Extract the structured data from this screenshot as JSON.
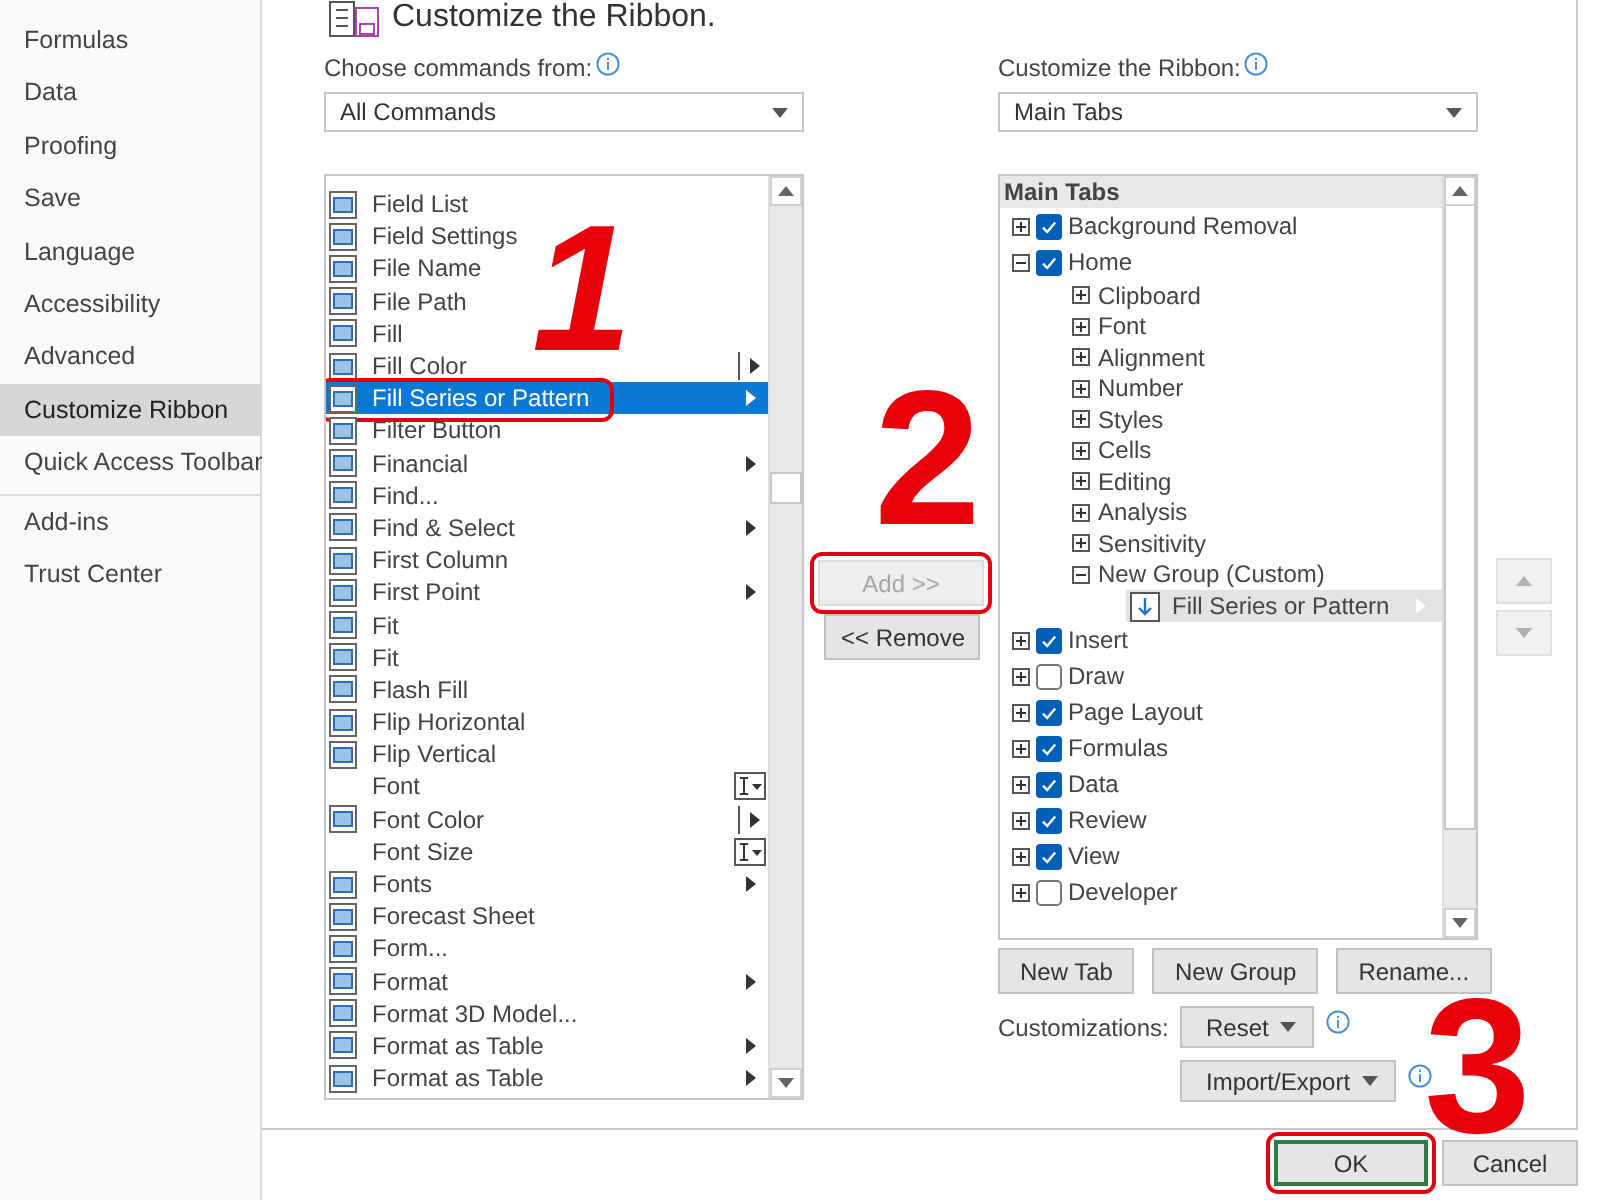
{
  "sidebar": {
    "sections": [
      {
        "items": [
          {
            "label": "Formulas",
            "selected": false
          },
          {
            "label": "Data",
            "selected": false
          },
          {
            "label": "Proofing",
            "selected": false
          },
          {
            "label": "Save",
            "selected": false
          },
          {
            "label": "Language",
            "selected": false
          },
          {
            "label": "Accessibility",
            "selected": false
          },
          {
            "label": "Advanced",
            "selected": false
          },
          {
            "label": "Customize Ribbon",
            "selected": true
          },
          {
            "label": "Quick Access Toolbar",
            "selected": false
          }
        ]
      },
      {
        "items": [
          {
            "label": "Add-ins",
            "selected": false
          },
          {
            "label": "Trust Center",
            "selected": false
          }
        ]
      }
    ]
  },
  "title": "Customize the Ribbon.",
  "commands_panel": {
    "label": "Choose commands from:",
    "dropdown": "All Commands",
    "items": [
      {
        "label": "Field List",
        "kind": "plain",
        "icon": true,
        "selected": false,
        "highlighted": false
      },
      {
        "label": "Field Settings",
        "kind": "plain",
        "icon": true,
        "selected": false,
        "highlighted": false
      },
      {
        "label": "File Name",
        "kind": "plain",
        "icon": true,
        "selected": false,
        "highlighted": false
      },
      {
        "label": "File Path",
        "kind": "plain",
        "icon": true,
        "selected": false,
        "highlighted": false
      },
      {
        "label": "Fill",
        "kind": "plain",
        "icon": true,
        "selected": false,
        "highlighted": false
      },
      {
        "label": "Fill Color",
        "kind": "split",
        "icon": true,
        "selected": false,
        "highlighted": false
      },
      {
        "label": "Fill Series or Pattern",
        "kind": "submenu",
        "icon": true,
        "selected": true,
        "highlighted": true
      },
      {
        "label": "Filter Button",
        "kind": "plain",
        "icon": true,
        "selected": false,
        "highlighted": false
      },
      {
        "label": "Financial",
        "kind": "submenu",
        "icon": true,
        "selected": false,
        "highlighted": false
      },
      {
        "label": "Find...",
        "kind": "plain",
        "icon": true,
        "selected": false,
        "highlighted": false
      },
      {
        "label": "Find & Select",
        "kind": "submenu",
        "icon": true,
        "selected": false,
        "highlighted": false
      },
      {
        "label": "First Column",
        "kind": "plain",
        "icon": true,
        "selected": false,
        "highlighted": false
      },
      {
        "label": "First Point",
        "kind": "submenu",
        "icon": true,
        "selected": false,
        "highlighted": false
      },
      {
        "label": "Fit",
        "kind": "plain",
        "icon": true,
        "selected": false,
        "highlighted": false
      },
      {
        "label": "Fit",
        "kind": "plain",
        "icon": true,
        "selected": false,
        "highlighted": false
      },
      {
        "label": "Flash Fill",
        "kind": "plain",
        "icon": true,
        "selected": false,
        "highlighted": false
      },
      {
        "label": "Flip Horizontal",
        "kind": "plain",
        "icon": true,
        "selected": false,
        "highlighted": false
      },
      {
        "label": "Flip Vertical",
        "kind": "plain",
        "icon": true,
        "selected": false,
        "highlighted": false
      },
      {
        "label": "Font",
        "kind": "textbox",
        "icon": false,
        "selected": false,
        "highlighted": false
      },
      {
        "label": "Font Color",
        "kind": "split",
        "icon": true,
        "selected": false,
        "highlighted": false
      },
      {
        "label": "Font Size",
        "kind": "textbox",
        "icon": false,
        "selected": false,
        "highlighted": false
      },
      {
        "label": "Fonts",
        "kind": "submenu",
        "icon": true,
        "selected": false,
        "highlighted": false
      },
      {
        "label": "Forecast Sheet",
        "kind": "plain",
        "icon": true,
        "selected": false,
        "highlighted": false
      },
      {
        "label": "Form...",
        "kind": "plain",
        "icon": true,
        "selected": false,
        "highlighted": false
      },
      {
        "label": "Format",
        "kind": "submenu",
        "icon": true,
        "selected": false,
        "highlighted": false
      },
      {
        "label": "Format 3D Model...",
        "kind": "plain",
        "icon": true,
        "selected": false,
        "highlighted": false
      },
      {
        "label": "Format as Table",
        "kind": "submenu",
        "icon": true,
        "selected": false,
        "highlighted": false
      },
      {
        "label": "Format as Table",
        "kind": "submenu",
        "icon": true,
        "selected": false,
        "highlighted": false
      }
    ]
  },
  "transfer_buttons": [
    {
      "label": "Add >>",
      "disabled": true,
      "highlighted": true
    },
    {
      "label": "<< Remove",
      "disabled": false,
      "highlighted": false
    }
  ],
  "ribbon_panel": {
    "label": "Customize the Ribbon:",
    "dropdown": "Main Tabs",
    "tree_header": "Main Tabs",
    "tree": [
      {
        "label": "Background Removal",
        "kind": "tab",
        "checked": true,
        "expanded": false,
        "selected": false
      },
      {
        "label": "Home",
        "kind": "tab",
        "checked": true,
        "expanded": true,
        "selected": false,
        "children": [
          {
            "label": "Clipboard",
            "kind": "group",
            "expanded": false,
            "selected": false
          },
          {
            "label": "Font",
            "kind": "group",
            "expanded": false,
            "selected": false
          },
          {
            "label": "Alignment",
            "kind": "group",
            "expanded": false,
            "selected": false
          },
          {
            "label": "Number",
            "kind": "group",
            "expanded": false,
            "selected": false
          },
          {
            "label": "Styles",
            "kind": "group",
            "expanded": false,
            "selected": false
          },
          {
            "label": "Cells",
            "kind": "group",
            "expanded": false,
            "selected": false
          },
          {
            "label": "Editing",
            "kind": "group",
            "expanded": false,
            "selected": false
          },
          {
            "label": "Analysis",
            "kind": "group",
            "expanded": false,
            "selected": false
          },
          {
            "label": "Sensitivity",
            "kind": "group",
            "expanded": false,
            "selected": false
          },
          {
            "label": "New Group (Custom)",
            "kind": "group",
            "expanded": true,
            "selected": false,
            "children": [
              {
                "label": "Fill Series or Pattern",
                "kind": "command",
                "selected": true
              }
            ]
          }
        ]
      },
      {
        "label": "Insert",
        "kind": "tab",
        "checked": true,
        "expanded": false,
        "selected": false
      },
      {
        "label": "Draw",
        "kind": "tab",
        "checked": false,
        "expanded": false,
        "selected": false
      },
      {
        "label": "Page Layout",
        "kind": "tab",
        "checked": true,
        "expanded": false,
        "selected": false
      },
      {
        "label": "Formulas",
        "kind": "tab",
        "checked": true,
        "expanded": false,
        "selected": false
      },
      {
        "label": "Data",
        "kind": "tab",
        "checked": true,
        "expanded": false,
        "selected": false
      },
      {
        "label": "Review",
        "kind": "tab",
        "checked": true,
        "expanded": false,
        "selected": false
      },
      {
        "label": "View",
        "kind": "tab",
        "checked": true,
        "expanded": false,
        "selected": false
      },
      {
        "label": "Developer",
        "kind": "tab",
        "checked": false,
        "expanded": false,
        "selected": false
      }
    ]
  },
  "move_buttons": [
    {
      "kind": "up",
      "disabled": true
    },
    {
      "kind": "down",
      "disabled": true
    }
  ],
  "tree_buttons": [
    {
      "label": "New Tab"
    },
    {
      "label": "New Group"
    },
    {
      "label": "Rename..."
    }
  ],
  "customizations": {
    "label": "Customizations:",
    "buttons": [
      {
        "label": "Reset"
      },
      {
        "label": "Import/Export"
      }
    ]
  },
  "footer": {
    "buttons": [
      {
        "label": "OK",
        "default": true,
        "highlighted": true
      },
      {
        "label": "Cancel",
        "default": false,
        "highlighted": false
      }
    ]
  },
  "annotations": [
    {
      "label": "1"
    },
    {
      "label": "2"
    },
    {
      "label": "3"
    }
  ]
}
